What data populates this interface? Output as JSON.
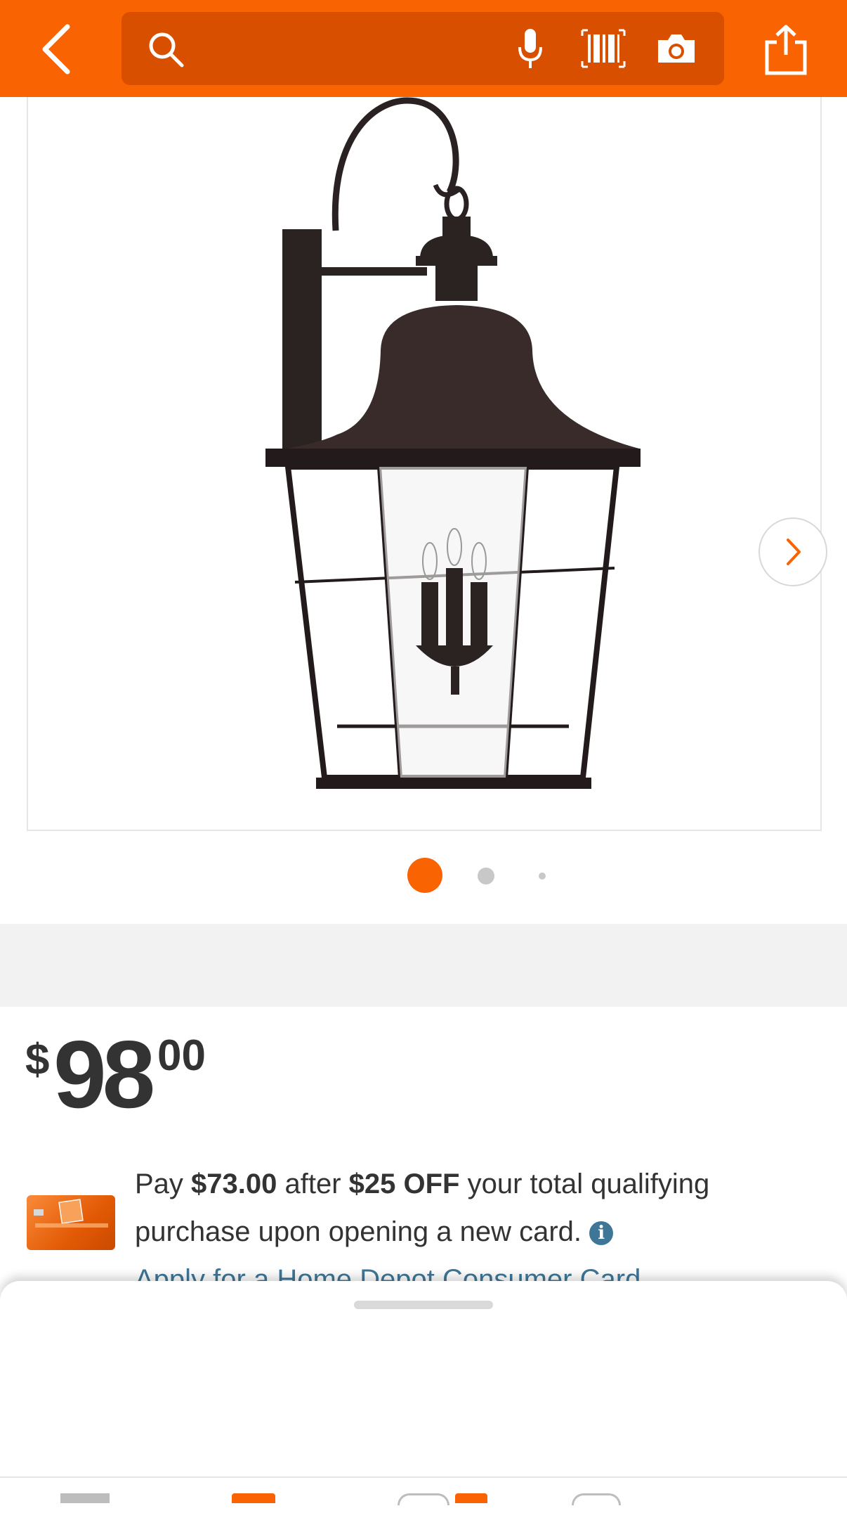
{
  "header": {
    "search_placeholder": "",
    "icons": [
      "back-chevron-icon",
      "search-icon",
      "microphone-icon",
      "barcode-icon",
      "camera-icon",
      "share-icon"
    ]
  },
  "gallery": {
    "image": "outdoor wall lantern",
    "dots_total": 3,
    "active_dot": 1
  },
  "price": {
    "currency": "$",
    "dollars": "98",
    "cents": "00"
  },
  "promo": {
    "pay_text": "Pay ",
    "pay_amount": "$73.00",
    "after_text": " after ",
    "off_amount": "$25 OFF",
    "rest_text": " your total qualifying purchase upon opening a new card. ",
    "info_glyph": "i",
    "link_text": "Apply for a Home Depot Consumer Card"
  },
  "colors": {
    "brand_orange": "#f96302",
    "search_bg": "#d94f00",
    "link_blue": "#3e7697"
  }
}
